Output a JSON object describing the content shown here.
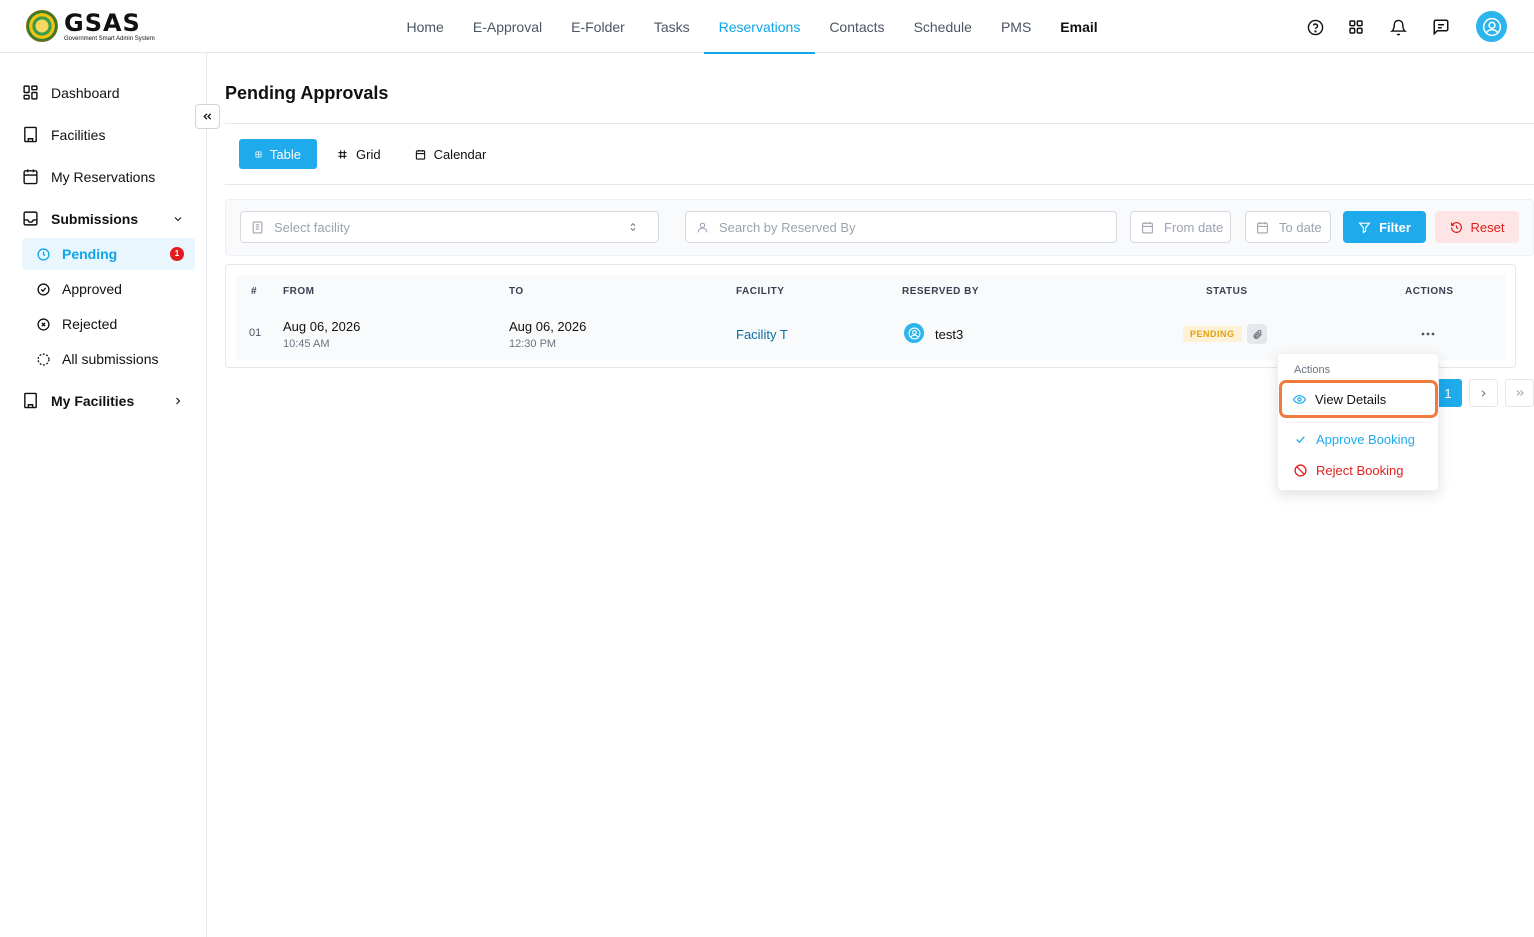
{
  "app": {
    "logo_title": "GSAS",
    "logo_subtitle": "Government Smart Admin System"
  },
  "nav": {
    "items": [
      "Home",
      "E-Approval",
      "E-Folder",
      "Tasks",
      "Reservations",
      "Contacts",
      "Schedule",
      "PMS",
      "Email"
    ],
    "active": "Reservations"
  },
  "top_icons": [
    "help-icon",
    "apps-grid-icon",
    "bell-icon",
    "chat-icon",
    "user-avatar-icon"
  ],
  "sidebar": {
    "dashboard": "Dashboard",
    "facilities": "Facilities",
    "my_reservations": "My Reservations",
    "submissions": "Submissions",
    "pending": "Pending",
    "pending_count": "1",
    "approved": "Approved",
    "rejected": "Rejected",
    "all_submissions": "All submissions",
    "my_facilities": "My Facilities"
  },
  "main": {
    "title": "Pending Approvals",
    "view_tabs": [
      "Table",
      "Grid",
      "Calendar"
    ],
    "active_tab": "Table"
  },
  "filters": {
    "facility_placeholder": "Select facility",
    "search_placeholder": "Search by Reserved By",
    "from_placeholder": "From date",
    "to_placeholder": "To date",
    "filter_label": "Filter",
    "reset_label": "Reset"
  },
  "table": {
    "headers": {
      "num": "#",
      "from": "FROM",
      "to": "TO",
      "facility": "FACILITY",
      "reserved_by": "RESERVED BY",
      "status": "STATUS",
      "actions": "ACTIONS"
    },
    "rows": [
      {
        "num": "01",
        "from_date": "Aug 06, 2026",
        "from_time": "10:45 AM",
        "to_date": "Aug 06, 2026",
        "to_time": "12:30 PM",
        "facility": "Facility T",
        "reserved_by": "test3",
        "status": "PENDING"
      }
    ]
  },
  "pagination": {
    "current": "1"
  },
  "actions_menu": {
    "heading": "Actions",
    "view": "View Details",
    "approve": "Approve Booking",
    "reject": "Reject Booking"
  },
  "colors": {
    "accent": "#1eaaeb",
    "danger": "#e11d1d",
    "pending": "#e3a008",
    "highlight": "#f27a3d"
  }
}
